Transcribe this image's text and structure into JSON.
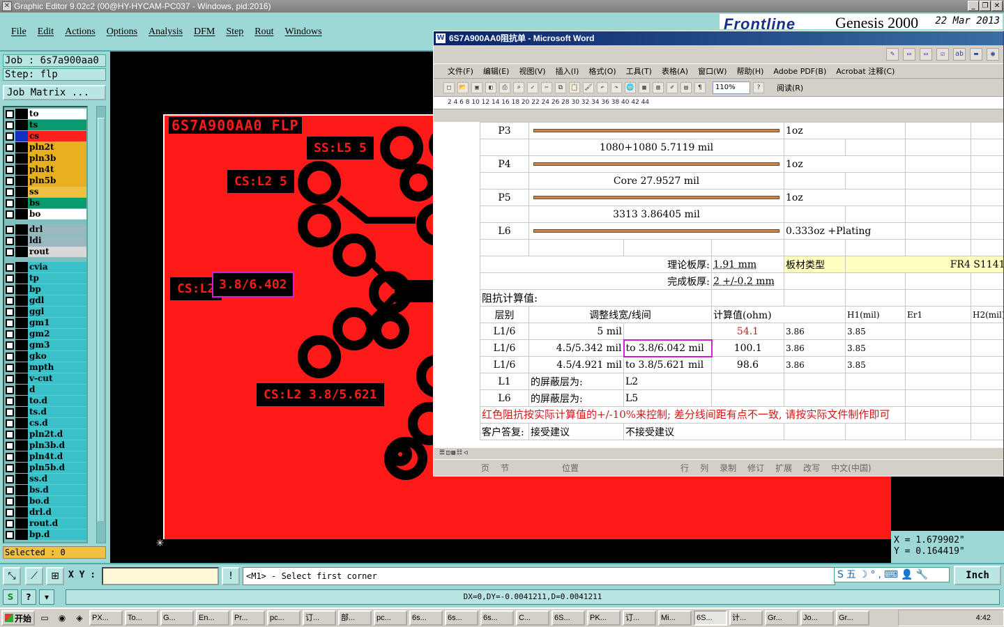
{
  "genesis": {
    "title": "Graphic Editor 9.02c2 (00@HY-HYCAM-PC037 - Windows, pid:2016)",
    "menu": [
      "File",
      "Edit",
      "Actions",
      "Options",
      "Analysis",
      "DFM",
      "Step",
      "Rout",
      "Windows"
    ],
    "brand": {
      "logo": "Frontline",
      "product": "Genesis 2000",
      "date": "22 Mar 2013"
    },
    "job": "Job :  6s7a900aa0",
    "step": "Step: flp",
    "job_matrix": "Job Matrix ...",
    "selected": "Selected : 0",
    "layers": [
      {
        "name": "to",
        "color": "#ffffff"
      },
      {
        "name": "ts",
        "color": "#0a9a70"
      },
      {
        "name": "cs",
        "color": "#ff2020",
        "active": true
      },
      {
        "name": "pln2t",
        "color": "#e8b020"
      },
      {
        "name": "pln3b",
        "color": "#e8b020"
      },
      {
        "name": "pln4t",
        "color": "#e8b020"
      },
      {
        "name": "pln5b",
        "color": "#e8b020"
      },
      {
        "name": "ss",
        "color": "#f0c040"
      },
      {
        "name": "bs",
        "color": "#0a9a70"
      },
      {
        "name": "bo",
        "color": "#ffffff"
      },
      {
        "name": "drl",
        "color": "#9ab8c0"
      },
      {
        "name": "ldi",
        "color": "#9ab8c0"
      },
      {
        "name": "rout",
        "color": "#d8d8d8"
      },
      {
        "name": "cvia",
        "color": "#3ac0c8"
      },
      {
        "name": "tp",
        "color": "#3ac0c8"
      },
      {
        "name": "bp",
        "color": "#3ac0c8"
      },
      {
        "name": "gdl",
        "color": "#3ac0c8"
      },
      {
        "name": "ggl",
        "color": "#3ac0c8"
      },
      {
        "name": "gm1",
        "color": "#3ac0c8"
      },
      {
        "name": "gm2",
        "color": "#3ac0c8"
      },
      {
        "name": "gm3",
        "color": "#3ac0c8"
      },
      {
        "name": "gko",
        "color": "#3ac0c8"
      },
      {
        "name": "mpth",
        "color": "#3ac0c8"
      },
      {
        "name": "v-cut",
        "color": "#3ac0c8"
      },
      {
        "name": "d",
        "color": "#3ac0c8"
      },
      {
        "name": "to.d",
        "color": "#3ac0c8"
      },
      {
        "name": "ts.d",
        "color": "#3ac0c8"
      },
      {
        "name": "cs.d",
        "color": "#3ac0c8"
      },
      {
        "name": "pln2t.d",
        "color": "#3ac0c8"
      },
      {
        "name": "pln3b.d",
        "color": "#3ac0c8"
      },
      {
        "name": "pln4t.d",
        "color": "#3ac0c8"
      },
      {
        "name": "pln5b.d",
        "color": "#3ac0c8"
      },
      {
        "name": "ss.d",
        "color": "#3ac0c8"
      },
      {
        "name": "bs.d",
        "color": "#3ac0c8"
      },
      {
        "name": "bo.d",
        "color": "#3ac0c8"
      },
      {
        "name": "drl.d",
        "color": "#3ac0c8"
      },
      {
        "name": "rout.d",
        "color": "#3ac0c8"
      },
      {
        "name": "bp.d",
        "color": "#3ac0c8"
      }
    ],
    "board": {
      "title": "6S7A900AA0 FLP",
      "labels": [
        "SS:L5 5",
        "CS:L2 5",
        "CS:L2",
        "3.8/6.402",
        "CS:L2 3.8/5.621"
      ]
    },
    "coords": {
      "x": "X  =  1.679902\"",
      "y": "Y  =  0.164419\""
    },
    "xy_label": "X Y :",
    "prompt": "<M1> - Select first corner",
    "ime": "五",
    "unit": "Inch",
    "dx": "DX=0,DY=-0.0041211,D=0.0041211"
  },
  "word": {
    "title": "6S7A900AA0阻抗单 - Microsoft Word",
    "menu": [
      "文件(F)",
      "编辑(E)",
      "视图(V)",
      "插入(I)",
      "格式(O)",
      "工具(T)",
      "表格(A)",
      "窗口(W)",
      "帮助(H)",
      "Adobe PDF(B)",
      "Acrobat 注释(C)"
    ],
    "zoom": "110%",
    "read": "阅读(R)",
    "ruler": "2  4  6  8  10  12  14  16  18  20  22  24  26  28  30  32  34  36  38  40  42  44",
    "stack": [
      {
        "layer": "P3",
        "right": "1oz"
      },
      {
        "mid": "1080+1080     5.7119 mil"
      },
      {
        "layer": "P4",
        "right": "1oz"
      },
      {
        "mid": "Core     27.9527 mil"
      },
      {
        "layer": "P5",
        "right": "1oz"
      },
      {
        "mid": "3313     3.86405 mil"
      },
      {
        "layer": "L6",
        "right": "0.333oz +Plating"
      }
    ],
    "thickness_label": "理论板厚:",
    "thickness_value": "1.91 mm",
    "material_label": "板材类型",
    "material_value": "FR4 S1141",
    "finish_label": "完成板厚:",
    "finish_value": "2 +/-0.2 mm",
    "calc_title": "阻抗计算值:",
    "headers": [
      "层别",
      "调整线宽/线间",
      "计算值(ohm)",
      "H1(mil)",
      "Er1",
      "H2(mil)"
    ],
    "rows": [
      {
        "layer": "L1/6",
        "width": "5 mil",
        "to": "",
        "val": "54.1",
        "h1": "3.86",
        "er1": "3.85"
      },
      {
        "layer": "L1/6",
        "width": "4.5/5.342 mil",
        "to": "to  3.8/6.042 mil",
        "val": "100.1",
        "h1": "3.86",
        "er1": "3.85"
      },
      {
        "layer": "L1/6",
        "width": "4.5/4.921 mil",
        "to": "to  3.8/5.621 mil",
        "val": "98.6",
        "h1": "3.86",
        "er1": "3.85"
      }
    ],
    "shield": [
      {
        "layer": "L1",
        "label": "的屏蔽层为:",
        "value": "L2"
      },
      {
        "layer": "L6",
        "label": "的屏蔽层为:",
        "value": "L5"
      }
    ],
    "note": "红色阻抗按实际计算值的+/-10%来控制; 差分线间距有点不一致, 请按实际文件制作即可",
    "reply": [
      "客户答复:",
      "接受建议",
      "不接受建议"
    ],
    "status": [
      "页",
      "节",
      "位置",
      "行",
      "列",
      "录制",
      "修订",
      "扩展",
      "改写",
      "中文(中国)"
    ]
  },
  "taskbar": {
    "start": "开始",
    "tasks": [
      "PX...",
      "To...",
      "G...",
      "En...",
      "Pr...",
      "pc...",
      "订...",
      "部...",
      "pc...",
      "6s...",
      "6s...",
      "6s...",
      "C...",
      "6S...",
      "PK...",
      "订...",
      "Mi...",
      "6S...",
      "计...",
      "Gr...",
      "Jo...",
      "Gr..."
    ],
    "clock": "4:42"
  }
}
